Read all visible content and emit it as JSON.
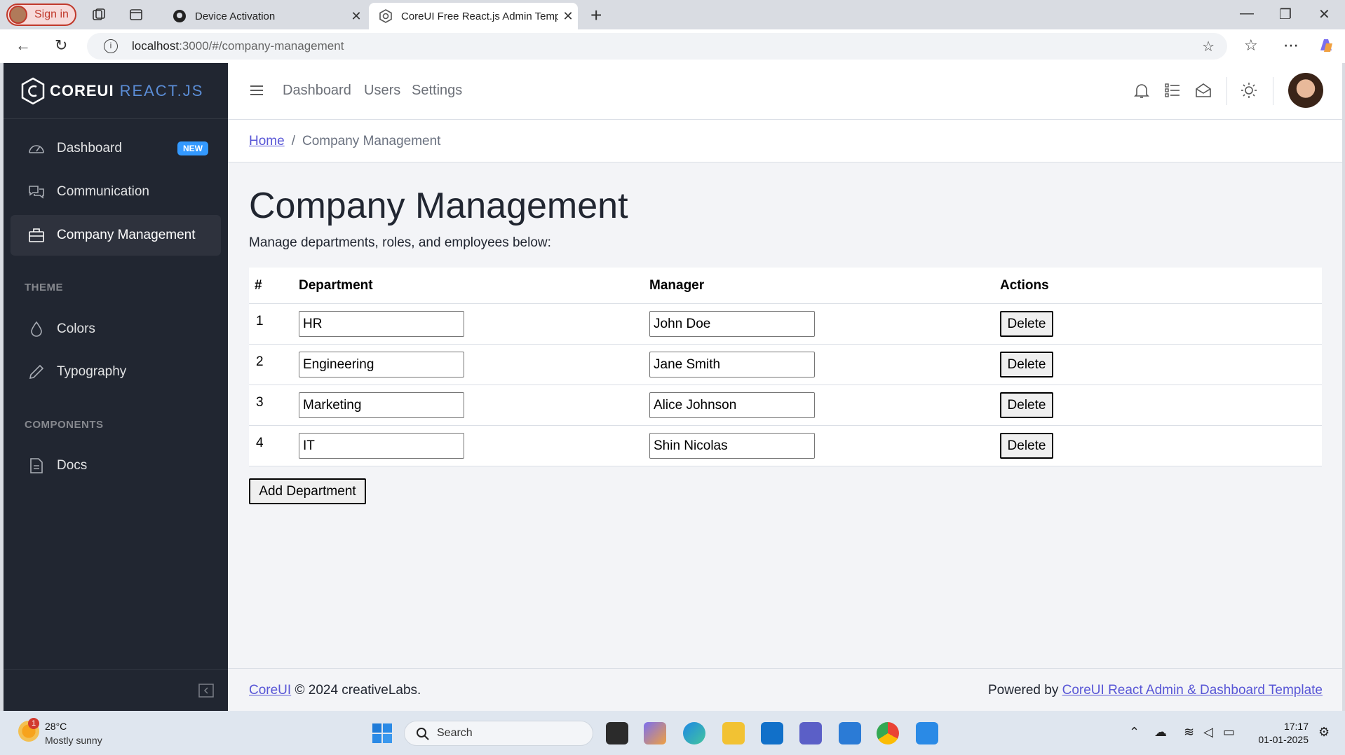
{
  "browser": {
    "signin_label": "Sign in",
    "tabs": [
      {
        "title": "Device Activation",
        "active": false
      },
      {
        "title": "CoreUI Free React.js Admin Templ",
        "active": true
      }
    ],
    "url_host": "localhost",
    "url_rest": ":3000/#/company-management"
  },
  "sidebar": {
    "brand_core": "COREUI",
    "brand_react": "REACT.JS",
    "items": [
      {
        "label": "Dashboard",
        "badge": "NEW",
        "icon": "speedometer-icon"
      },
      {
        "label": "Communication",
        "icon": "chat-icon"
      },
      {
        "label": "Company Management",
        "icon": "briefcase-icon",
        "active": true
      }
    ],
    "theme_title": "THEME",
    "theme_items": [
      {
        "label": "Colors",
        "icon": "drop-icon"
      },
      {
        "label": "Typography",
        "icon": "pencil-icon"
      }
    ],
    "components_title": "COMPONENTS",
    "component_items": [
      {
        "label": "Docs",
        "icon": "document-icon"
      }
    ]
  },
  "header": {
    "links": [
      "Dashboard",
      "Users",
      "Settings"
    ]
  },
  "breadcrumb": {
    "home": "Home",
    "separator": "/",
    "current": "Company Management"
  },
  "main": {
    "title": "Company Management",
    "subtitle": "Manage departments, roles, and employees below:",
    "columns": [
      "#",
      "Department",
      "Manager",
      "Actions"
    ],
    "rows": [
      {
        "num": "1",
        "department": "HR",
        "manager": "John Doe",
        "action": "Delete"
      },
      {
        "num": "2",
        "department": "Engineering",
        "manager": "Jane Smith",
        "action": "Delete"
      },
      {
        "num": "3",
        "department": "Marketing",
        "manager": "Alice Johnson",
        "action": "Delete"
      },
      {
        "num": "4",
        "department": "IT",
        "manager": "Shin Nicolas",
        "action": "Delete"
      }
    ],
    "add_button": "Add Department"
  },
  "footer": {
    "left_link": "CoreUI",
    "left_text": "© 2024 creativeLabs.",
    "right_text": "Powered by",
    "right_link": "CoreUI React Admin & Dashboard Template"
  },
  "taskbar": {
    "weather_badge": "1",
    "temperature": "28°C",
    "weather": "Mostly sunny",
    "search_label": "Search",
    "time": "17:17",
    "date": "01-01-2025"
  },
  "colors": {
    "sidebar_bg": "#212631",
    "primary": "#5856d6",
    "badge": "#3399ff",
    "body_bg": "#f3f4f7"
  }
}
